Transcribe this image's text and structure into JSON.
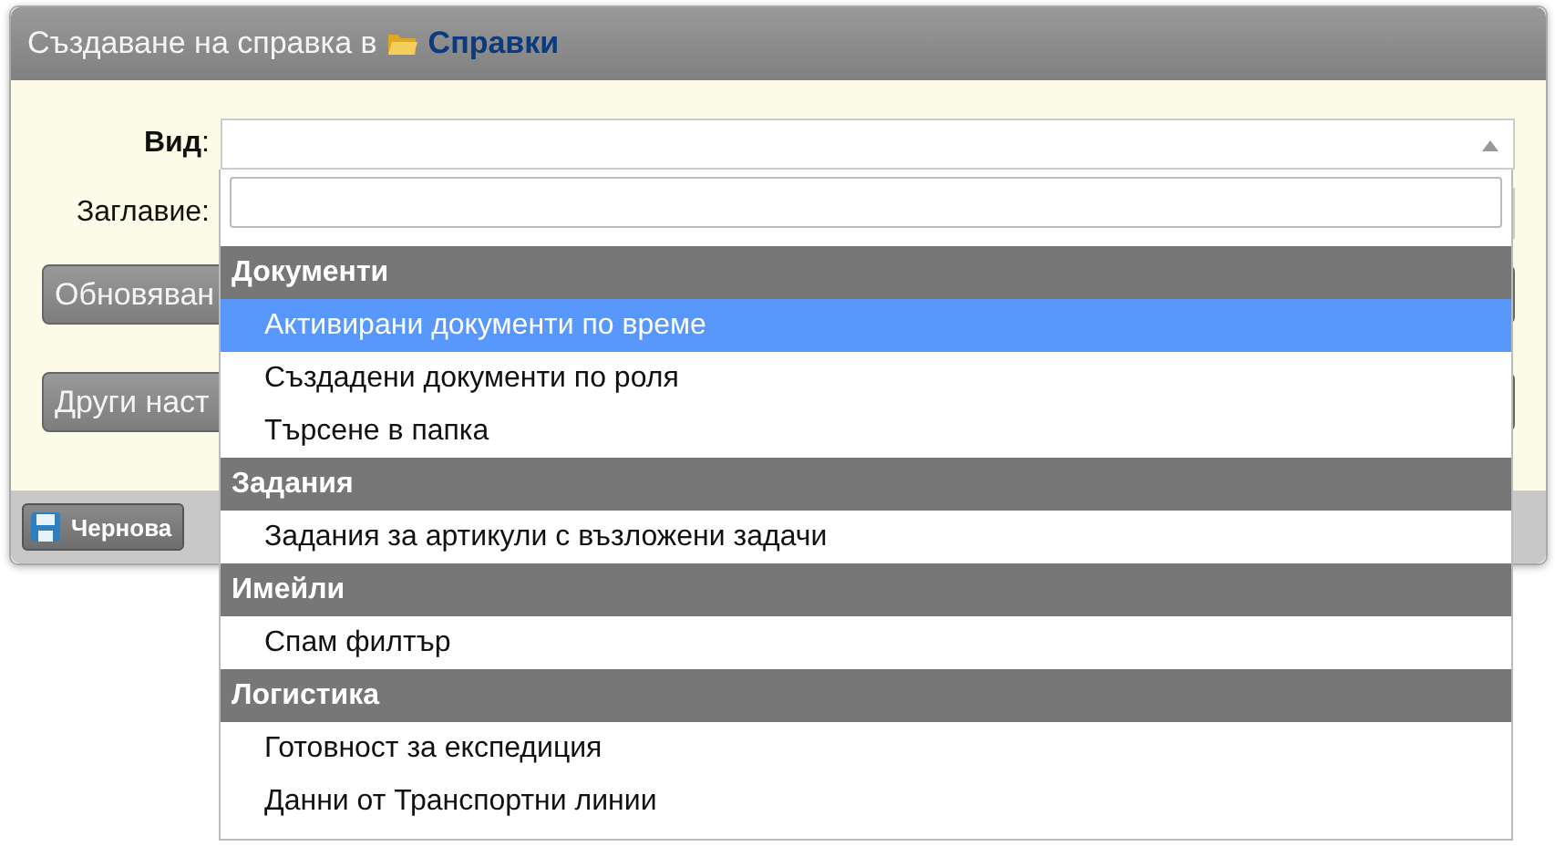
{
  "window": {
    "title": "Създаване на справка в",
    "folder_link": "Справки"
  },
  "form": {
    "fields": [
      {
        "label": "**Вид**:"
      },
      {
        "label": "Заглавие:"
      }
    ],
    "buttons": [
      "Обновяван",
      "Други наст"
    ]
  },
  "footer": {
    "buttons": [
      "Чернова"
    ]
  },
  "dropdown": {
    "groups": [
      {
        "label": "Документи",
        "items": [
          {
            "label": "Активирани документи по време",
            "selected": true
          },
          {
            "label": "Създадени документи по роля",
            "selected": false
          },
          {
            "label": "Търсене в папка",
            "selected": false
          }
        ]
      },
      {
        "label": "Задания",
        "items": [
          {
            "label": "Задания за артикули с възложени задачи",
            "selected": false
          }
        ]
      },
      {
        "label": "Имейли",
        "items": [
          {
            "label": "Спам филтър",
            "selected": false
          }
        ]
      },
      {
        "label": "Логистика",
        "items": [
          {
            "label": "Готовност за експедиция",
            "selected": false
          },
          {
            "label": "Данни от Транспортни линии",
            "selected": false
          }
        ]
      }
    ]
  }
}
